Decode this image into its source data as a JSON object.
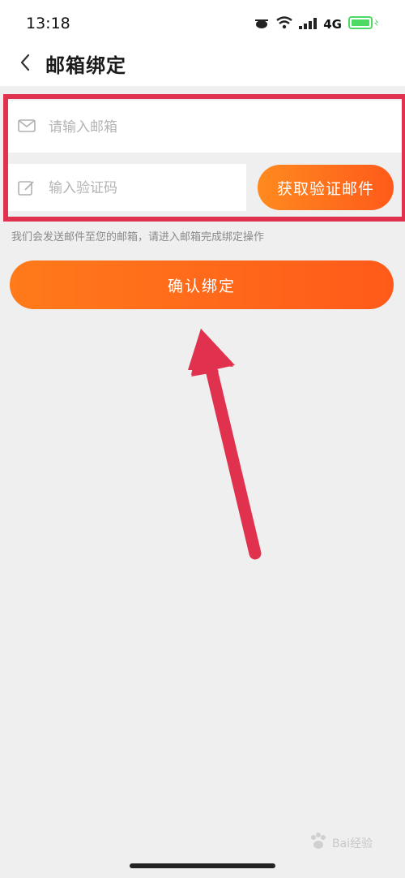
{
  "status_bar": {
    "time": "13:18",
    "network": "4G"
  },
  "header": {
    "title": "邮箱绑定"
  },
  "form": {
    "email_placeholder": "请输入邮箱",
    "email_value": "",
    "code_placeholder": "输入验证码",
    "code_value": "",
    "get_code_label": "获取验证邮件",
    "hint": "我们会发送邮件至您的邮箱，请进入邮箱完成绑定操作",
    "confirm_label": "确认绑定"
  },
  "watermark": {
    "text": "Bai经验"
  },
  "colors": {
    "accent_orange": "#ff6a1a",
    "annotation_red": "#e0324e",
    "battery_green": "#4cd964"
  },
  "icons": {
    "back": "chevron-left-icon",
    "email": "envelope-icon",
    "code": "edit-icon"
  }
}
